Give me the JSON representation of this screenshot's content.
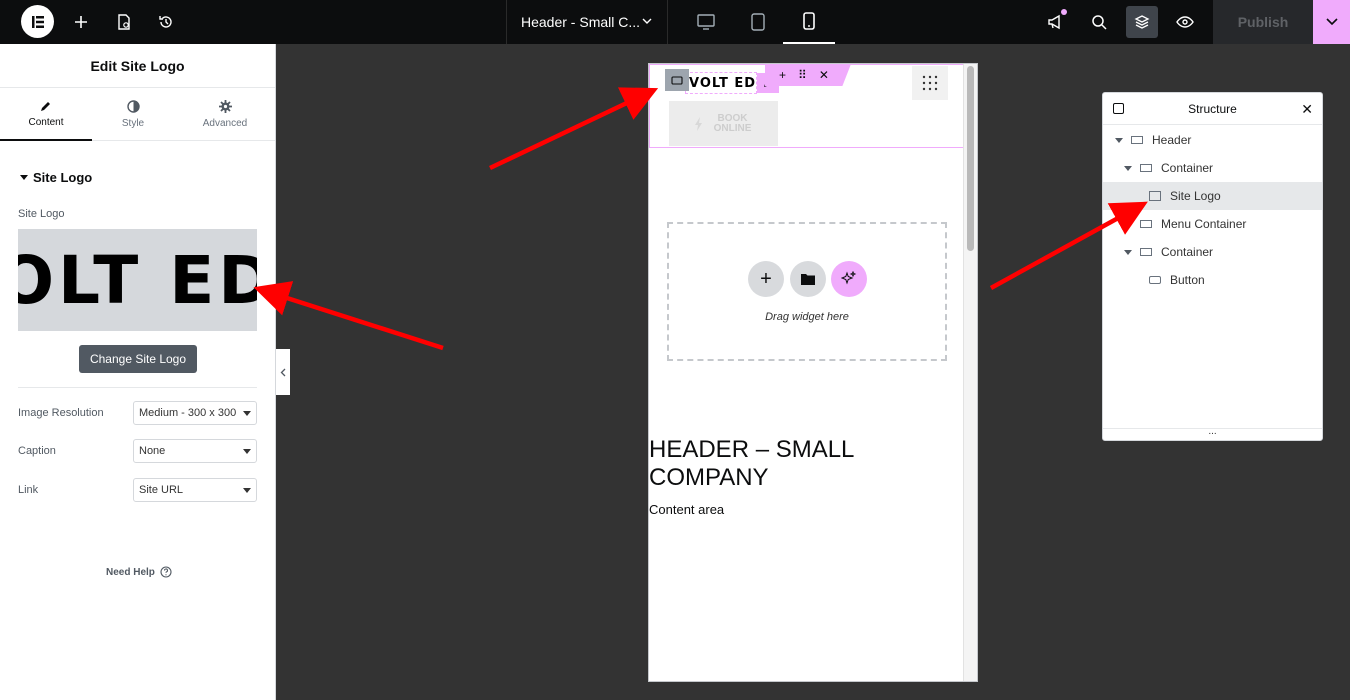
{
  "topbar": {
    "document_title": "Header - Small C...",
    "publish_label": "Publish",
    "devices": [
      "desktop-icon",
      "tablet-icon",
      "mobile-icon"
    ],
    "active_device": "mobile"
  },
  "panel": {
    "title": "Edit Site Logo",
    "tabs": [
      {
        "label": "Content",
        "icon": "pencil-icon"
      },
      {
        "label": "Style",
        "icon": "contrast-icon"
      },
      {
        "label": "Advanced",
        "icon": "gear-icon"
      }
    ],
    "section_title": "Site Logo",
    "logo_label": "Site Logo",
    "logo_preview_text": "OLT ED",
    "change_button": "Change Site Logo",
    "fields": [
      {
        "label": "Image Resolution",
        "value": "Medium - 300 x 300"
      },
      {
        "label": "Caption",
        "value": "None"
      },
      {
        "label": "Link",
        "value": "Site URL"
      }
    ],
    "need_help": "Need Help"
  },
  "canvas": {
    "logo_text": "VOLT EDG",
    "book_button": "BOOK ONLINE",
    "drag_hint": "Drag widget here",
    "heading": "HEADER – SMALL COMPANY",
    "content_text": "Content area"
  },
  "structure": {
    "title": "Structure",
    "items": [
      {
        "label": "Header",
        "depth": 0,
        "expanded": true,
        "selected": false
      },
      {
        "label": "Container",
        "depth": 1,
        "expanded": true,
        "selected": false
      },
      {
        "label": "Site Logo",
        "depth": 2,
        "expanded": false,
        "selected": true
      },
      {
        "label": "Menu Container",
        "depth": 1,
        "expanded": false,
        "selected": false
      },
      {
        "label": "Container",
        "depth": 1,
        "expanded": true,
        "selected": false
      },
      {
        "label": "Button",
        "depth": 2,
        "expanded": false,
        "selected": false
      }
    ]
  },
  "colors": {
    "accent_pink": "#f0abfc",
    "arrow_red": "#ff0000",
    "topbar_bg": "#0c0d0e"
  }
}
